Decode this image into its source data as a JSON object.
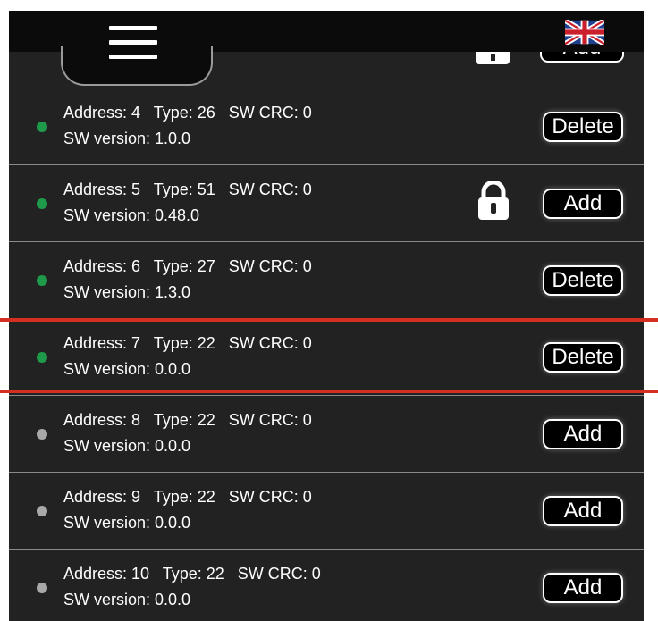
{
  "header": {
    "menu_icon": "hamburger-menu-icon",
    "language_icon": "uk-flag-icon"
  },
  "cutoff_item": {
    "button_label": "Add",
    "lock_icon": "lock-icon"
  },
  "colors": {
    "background": "#222222",
    "topbar": "#0b0b0b",
    "status_active": "#1f9a4a",
    "status_inactive": "#a8a8a8",
    "highlight": "#d32f22"
  },
  "devices": [
    {
      "line1": "Address: 4   Type: 26   SW CRC: 0",
      "line2": "SW version: 1.0.0",
      "status": "active",
      "button": "Delete",
      "locked": false
    },
    {
      "line1": "Address: 5   Type: 51   SW CRC: 0",
      "line2": "SW version: 0.48.0",
      "status": "active",
      "button": "Add",
      "locked": true
    },
    {
      "line1": "Address: 6   Type: 27   SW CRC: 0",
      "line2": "SW version: 1.3.0",
      "status": "active",
      "button": "Delete",
      "locked": false
    },
    {
      "line1": "Address: 7   Type: 22   SW CRC: 0",
      "line2": "SW version: 0.0.0",
      "status": "active",
      "button": "Delete",
      "locked": false,
      "highlighted": true
    },
    {
      "line1": "Address: 8   Type: 22   SW CRC: 0",
      "line2": "SW version: 0.0.0",
      "status": "inactive",
      "button": "Add",
      "locked": false
    },
    {
      "line1": "Address: 9   Type: 22   SW CRC: 0",
      "line2": "SW version: 0.0.0",
      "status": "inactive",
      "button": "Add",
      "locked": false
    },
    {
      "line1": "Address: 10   Type: 22   SW CRC: 0",
      "line2": "SW version: 0.0.0",
      "status": "inactive",
      "button": "Add",
      "locked": false
    }
  ]
}
